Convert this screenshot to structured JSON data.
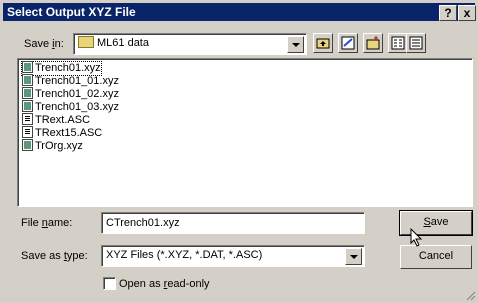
{
  "titlebar": {
    "title": "Select Output XYZ File",
    "help": "?",
    "close": "x"
  },
  "save_in": {
    "label_pre": "Save ",
    "label_key": "i",
    "label_post": "n:",
    "value": "ML61 data"
  },
  "files": [
    {
      "name": "Trench01.xyz",
      "type": "xyz"
    },
    {
      "name": "Trench01_01.xyz",
      "type": "xyz"
    },
    {
      "name": "Trench01_02.xyz",
      "type": "xyz"
    },
    {
      "name": "Trench01_03.xyz",
      "type": "xyz"
    },
    {
      "name": "TRext.ASC",
      "type": "asc"
    },
    {
      "name": "TRext15.ASC",
      "type": "asc"
    },
    {
      "name": "TrOrg.xyz",
      "type": "xyz"
    }
  ],
  "file_name": {
    "label_pre": "File ",
    "label_key": "n",
    "label_post": "ame:",
    "value": "CTrench01.xyz"
  },
  "save_type": {
    "label_pre": "Save as ",
    "label_key": "t",
    "label_post": "ype:",
    "value": "XYZ Files (*.XYZ, *.DAT, *.ASC)"
  },
  "buttons": {
    "save_key": "S",
    "save_rest": "ave",
    "cancel": "Cancel"
  },
  "read_only": {
    "label_pre": "Open as ",
    "label_key": "r",
    "label_post": "ead-only"
  }
}
